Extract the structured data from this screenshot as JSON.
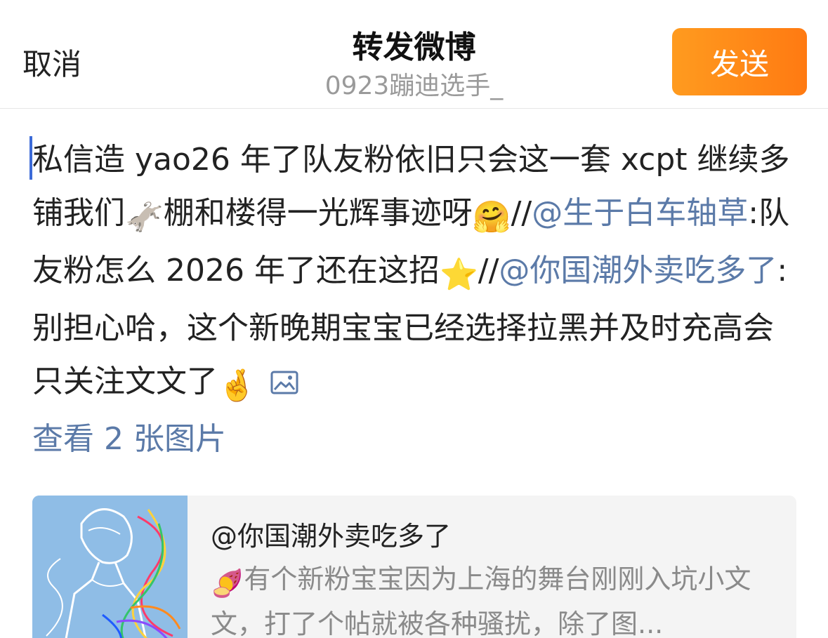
{
  "nav": {
    "cancel_label": "取消",
    "title": "转发微博",
    "subtitle": "0923蹦迪选手_",
    "send_label": "发送",
    "send_color": "#ff8a17"
  },
  "compose": {
    "seg1": "私信造 yao26 年了队友粉依旧只会这一套 xcpt 继续多铺我们",
    "donkey_emoji": "🫏",
    "seg2": "棚和楼得一光辉事迹呀",
    "laugh_emoji": "🤗",
    "seg3": "//",
    "mention1": "@生于白车轴草",
    "seg4": ":队友粉怎么 2026 年了还在这招",
    "star_emoji": "⭐",
    "seg5": "//",
    "mention2": "@你国潮外卖吃多了",
    "seg6": ":别担心哈，这个新晚期宝宝已经选择拉黑并及时充高会只关注文文了",
    "fingers_emoji": "🤞",
    "view_images_label": "查看 2 张图片"
  },
  "card": {
    "author": "@你国潮外卖吃多了",
    "sweet_potato_emoji": "🍠",
    "body": "有个新粉宝宝因为上海的舞台刚刚入坑小文文，打了个帖就被各种骚扰，除了图..."
  }
}
